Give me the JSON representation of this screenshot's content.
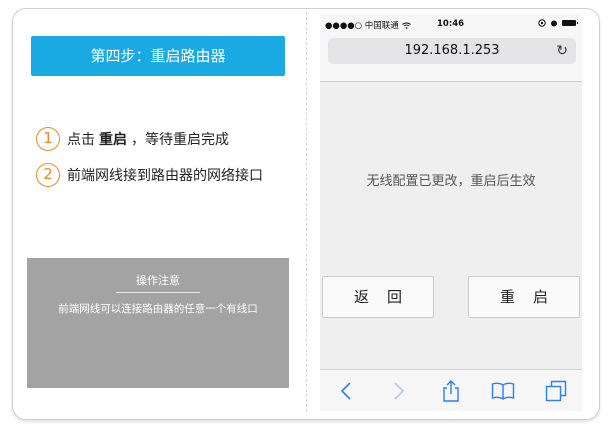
{
  "left": {
    "step_title": "第四步：重启路由器",
    "steps": [
      {
        "num": "1",
        "before": "点击",
        "bold": "重启",
        "after": "，等待重启完成"
      },
      {
        "num": "2",
        "before": "前端网线接到路由器的网络接口",
        "bold": "",
        "after": ""
      }
    ],
    "note": {
      "title": "操作注意",
      "text": "前端网线可以连接路由器的任意一个有线口"
    }
  },
  "phone": {
    "status": {
      "carrier": "●●●●○ 中国联通",
      "time": "10:46"
    },
    "url": "192.168.1.253",
    "message": "无线配置已更改，重启后生效",
    "buttons": {
      "back": "返回",
      "reboot": "重启"
    }
  },
  "colors": {
    "accent": "#1aaae3",
    "number": "#e88a2c",
    "note_bg": "#a3a3a3",
    "ios_blue": "#2a7ff5"
  }
}
